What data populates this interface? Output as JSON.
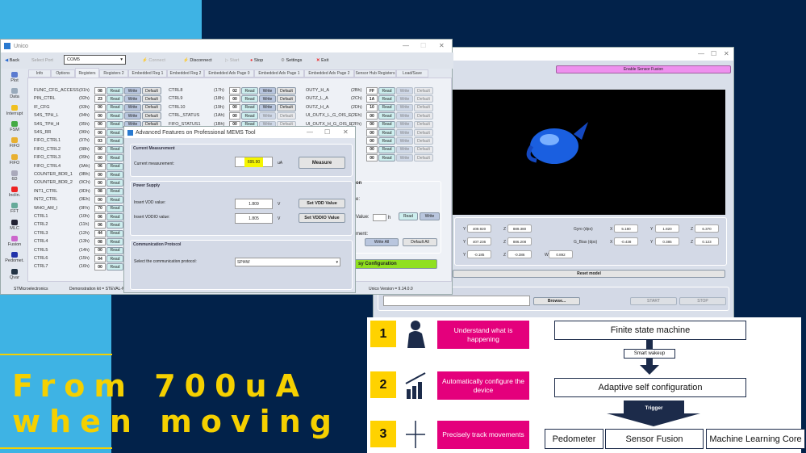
{
  "headline": {
    "line1": "From 700uA",
    "line2": "when moving"
  },
  "main_window": {
    "title": "Unico",
    "toolbar": {
      "back": "Back",
      "select_port": "Select Port",
      "port_value": "COM5",
      "connect": "Connect",
      "disconnect": "Disconnect",
      "start": "Start",
      "stop": "Stop",
      "settings": "Settings",
      "exit": "Exit"
    },
    "tabs": [
      "Info",
      "Options",
      "Registers",
      "Registers 2",
      "Embedded Reg 1",
      "Embedded Reg 2",
      "Embedded Adv Page 0",
      "Embedded Adv Page 1",
      "Embedded Adv Page 2",
      "Sensor Hub Registers",
      "Load/Save"
    ],
    "active_tab": "Registers",
    "sidebar": [
      "Plot",
      "Data",
      "Interrupt",
      "FSM",
      "FIFO",
      "FIFO",
      "6D",
      "Inclin.",
      "FFT",
      "MLC",
      "Fusion",
      "Pedomet.",
      "Qvar"
    ],
    "buttons": {
      "read": "Read",
      "write": "Write",
      "default": "Default"
    },
    "registers_col1": [
      [
        "FUNC_CFG_ACCESS",
        "(01h)",
        "08"
      ],
      [
        "PIN_CTRL",
        "(02h)",
        "23"
      ],
      [
        "IF_CFG",
        "(03h)",
        "00"
      ],
      [
        "S4S_TPH_L",
        "(04h)",
        "00"
      ],
      [
        "S4S_TPH_H",
        "(05h)",
        "00"
      ],
      [
        "S4S_RR",
        "(06h)",
        "00"
      ],
      [
        "FIFO_CTRL1",
        "(07h)",
        "03"
      ],
      [
        "FIFO_CTRL2",
        "(08h)",
        "00"
      ],
      [
        "FIFO_CTRL3",
        "(09h)",
        "00"
      ],
      [
        "FIFO_CTRL4",
        "(0Ah)",
        "06"
      ],
      [
        "COUNTER_BDR_1",
        "(0Bh)",
        "00"
      ],
      [
        "COUNTER_BDR_2",
        "(0Ch)",
        "00"
      ],
      [
        "INT1_CTRL",
        "(0Dh)",
        "08"
      ],
      [
        "INT2_CTRL",
        "(0Eh)",
        "00"
      ],
      [
        "WHO_AM_I",
        "(0Fh)",
        "70"
      ],
      [
        "CTRL1",
        "(10h)",
        "06"
      ],
      [
        "CTRL2",
        "(11h)",
        "06"
      ],
      [
        "CTRL3",
        "(12h)",
        "44"
      ],
      [
        "CTRL4",
        "(13h)",
        "08"
      ],
      [
        "CTRL5",
        "(14h)",
        "00"
      ],
      [
        "CTRL6",
        "(15h)",
        "04"
      ],
      [
        "CTRL7",
        "(16h)",
        "00"
      ]
    ],
    "registers_col2": [
      [
        "CTRL8",
        "(17h)",
        "02"
      ],
      [
        "CTRL9",
        "(18h)",
        "00"
      ],
      [
        "CTRL10",
        "(19h)",
        "00"
      ],
      [
        "CTRL_STATUS",
        "(1Ah)",
        "00"
      ],
      [
        "FIFO_STATUS1",
        "(1Bh)",
        "00"
      ]
    ],
    "registers_col3": [
      [
        "OUTY_H_A",
        "(2Bh)",
        "FF"
      ],
      [
        "OUTZ_L_A",
        "(2Ch)",
        "1A"
      ],
      [
        "OUTZ_H_A",
        "(2Dh)",
        "10"
      ],
      [
        "UI_OUTX_L_G_OIS_E",
        "(2Eh)",
        "00"
      ],
      [
        "UI_OUTX_H_G_OIS_E",
        "(2Fh)",
        "00"
      ],
      [
        "",
        "",
        "00"
      ],
      [
        "",
        "",
        "00"
      ],
      [
        "",
        "",
        "00"
      ],
      [
        "",
        "",
        "00"
      ]
    ],
    "partial": {
      "heading": "on",
      "label1": "e:",
      "value_label": "Value:",
      "value_unit": "h",
      "label2": "ment:",
      "write_all": "Write All",
      "default_all": "Default All",
      "easy_config": "sy Configuration"
    },
    "status": {
      "company": "STMicroelectronics",
      "kit": "Demonstration kit = STEVAL-M",
      "version": "Unico Version = 9.14.0.0"
    }
  },
  "dialog": {
    "title": "Advanced Features on Professional MEMS Tool",
    "current": {
      "title": "Current Measurement",
      "label": "Current measurement:",
      "value": "695.90",
      "unit": "uA",
      "button": "Measure"
    },
    "power": {
      "title": "Power Supply",
      "vdd_label": "Insert VDD value:",
      "vdd_value": "1.809",
      "vddio_label": "Insert VDDIO value:",
      "vddio_value": "1.805",
      "unit": "V",
      "set_vdd": "Set VDD Value",
      "set_vddio": "Set VDDIO Value"
    },
    "comm": {
      "title": "Communication Protocol",
      "label": "Select the communication protocol:",
      "value": "SPI4W"
    },
    "highlight_color": "#f5f500"
  },
  "fusion_window": {
    "enable_button": "Enable Sensor Fusion",
    "row1": {
      "y": "409.920",
      "z": "889.380",
      "label": "Gyro (dps)",
      "gx": "5.180",
      "gy": "1.820",
      "gz": "6.370"
    },
    "row2": {
      "y": "407.236",
      "z": "886.208",
      "label": "G_Bias (dps)",
      "gx": "-0.438",
      "gy": "0.385",
      "gz": "0.123"
    },
    "row3": {
      "y": "-0.185",
      "z": "-0.386",
      "w": "0.892"
    },
    "axis": {
      "x": "X",
      "y": "Y",
      "z": "Z",
      "w": "W"
    },
    "reset": "Reset model",
    "browse": "Browse...",
    "start": "START",
    "stop": "STOP"
  },
  "slide": {
    "steps": [
      {
        "num": "1",
        "text": "Understand what is happening",
        "icon": "thinking-person-icon"
      },
      {
        "num": "2",
        "text": "Automatically configure the device",
        "icon": "growth-chart-icon"
      },
      {
        "num": "3",
        "text": "Precisely track movements",
        "icon": "compass-cross-icon"
      }
    ],
    "fsm": "Finite state machine",
    "smart_wakeup": "Smart wakeup",
    "adaptive": "Adaptive self configuration",
    "trigger": "Trigger",
    "outputs": [
      "Pedometer",
      "Sensor Fusion",
      "Machine Learning Core"
    ],
    "colors": {
      "yellow": "#ffd200",
      "magenta": "#e4007c",
      "navy": "#1c2b4a"
    }
  }
}
